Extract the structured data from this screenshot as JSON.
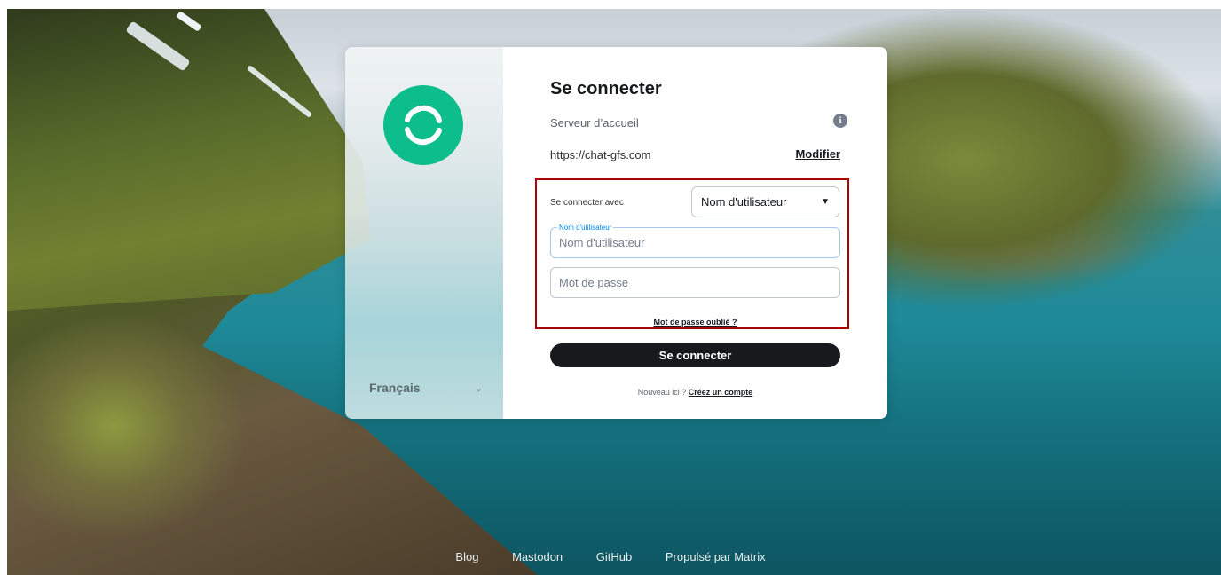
{
  "login": {
    "title": "Se connecter",
    "homeserver_label": "Serveur d’accueil",
    "homeserver_url": "https://chat-gfs.com",
    "edit_link": "Modifier",
    "login_with_label": "Se connecter avec",
    "login_method": "Nom d'utilisateur",
    "username_float_label": "Nom d'utilisateur",
    "username_placeholder": "Nom d'utilisateur",
    "password_placeholder": "Mot de passe",
    "forgot_password": "Mot de passe oublié ?",
    "submit": "Se connecter",
    "new_here": "Nouveau ici ?",
    "create_account": "Créez un compte"
  },
  "language": {
    "current": "Français"
  },
  "footer": {
    "links": [
      "Blog",
      "Mastodon",
      "GitHub",
      "Propulsé par Matrix"
    ]
  },
  "colors": {
    "brand_green": "#0dbd8b",
    "button_dark": "#17191c",
    "highlight_red": "#b00000"
  }
}
